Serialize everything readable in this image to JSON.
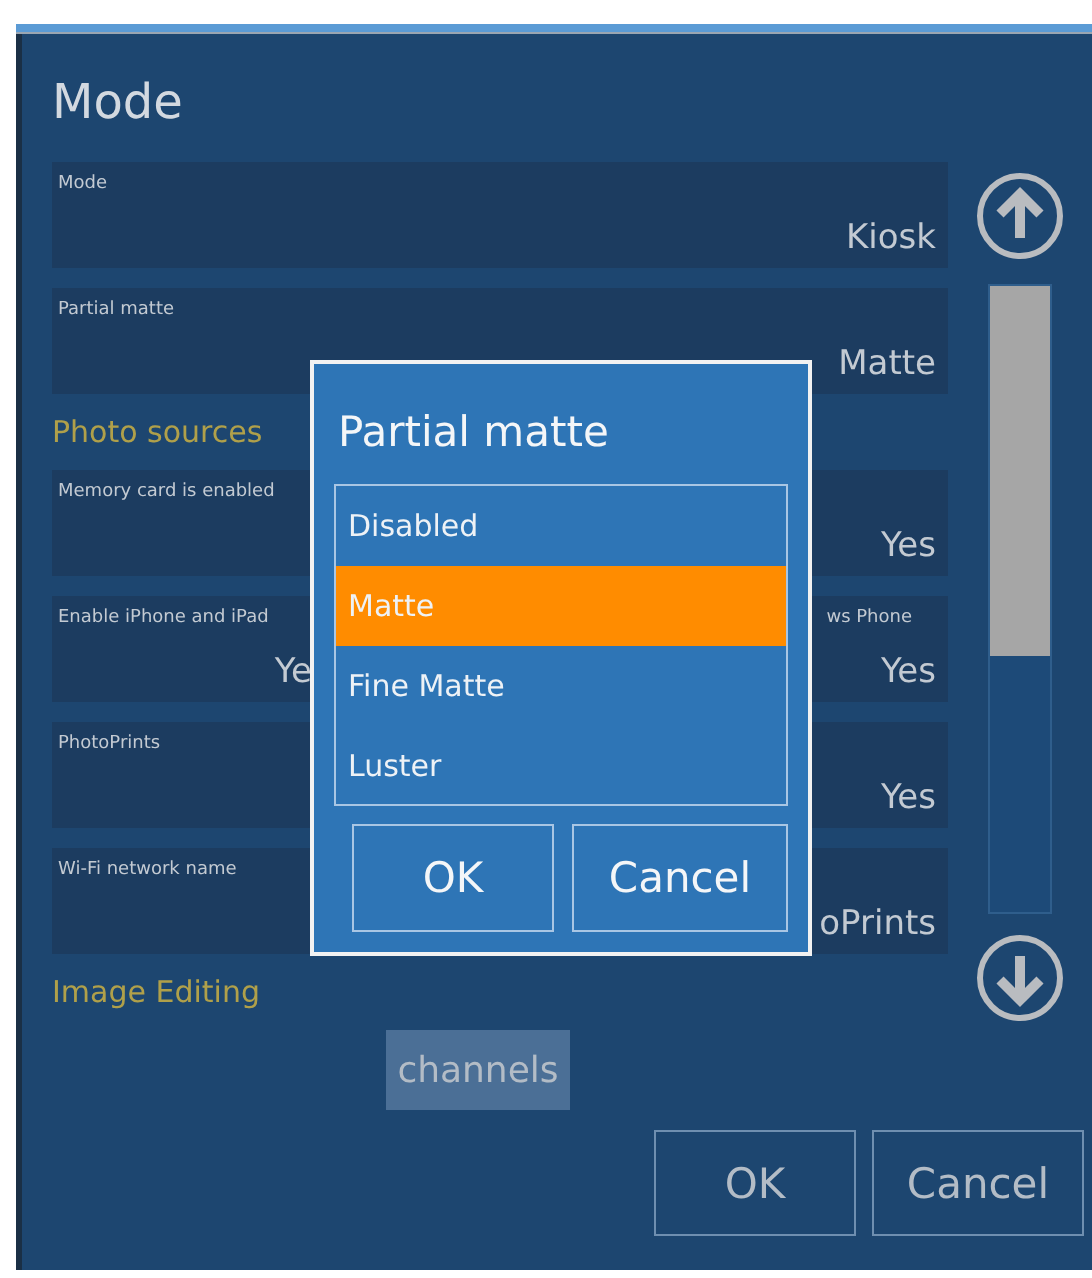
{
  "title": "Mode",
  "sections": [
    {
      "rows": [
        {
          "kind": "single",
          "label": "Mode",
          "value": "Kiosk"
        },
        {
          "kind": "single",
          "label": "Partial matte",
          "value": "Matte"
        }
      ]
    },
    {
      "heading": "Photo sources",
      "rows": [
        {
          "kind": "single",
          "label": "Memory card is enabled",
          "value": "Yes"
        },
        {
          "kind": "pair",
          "cells": [
            {
              "label": "Enable iPhone and iPad",
              "value": "Ye"
            },
            {
              "label": "ws Phone",
              "value": "Yes"
            }
          ]
        },
        {
          "kind": "single",
          "label": "PhotoPrints",
          "value": "Yes"
        },
        {
          "kind": "single",
          "label": "Wi-Fi network name",
          "value": "oPrints"
        }
      ]
    },
    {
      "heading": "Image Editing"
    }
  ],
  "channels_button": "channels",
  "buttons": [
    "OK",
    "Cancel"
  ],
  "dialog": {
    "title": "Partial matte",
    "options": [
      {
        "label": "Disabled",
        "selected": false
      },
      {
        "label": "Matte",
        "selected": true
      },
      {
        "label": "Fine Matte",
        "selected": false
      },
      {
        "label": "Luster",
        "selected": false
      }
    ],
    "buttons": [
      "OK",
      "Cancel"
    ]
  }
}
